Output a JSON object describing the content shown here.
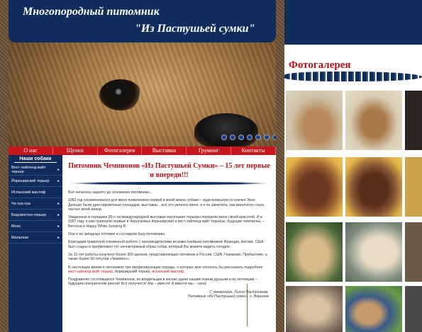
{
  "header": {
    "title": "Многопородный питомник",
    "subtitle": "\"Из Пастушьей сумки\""
  },
  "nav": [
    "О нас",
    "Щенки",
    "Фотогалерея",
    "Выставки",
    "Груминг",
    "Контакты"
  ],
  "sidebar": {
    "title": "Наши собаки",
    "items": [
      "Вест-хайленд-вайт терьер",
      "Йоркширский терьер",
      "Испанский мастиф",
      "Чи хуа хуа",
      "Бедлингтон-терьер",
      "Мопс",
      "Мальтезе"
    ]
  },
  "content": {
    "title": "Питомник Чемпионов «Из Пастушьей Сумки» – 15 лет первые и впереди!!!",
    "p1": "Всё началось задолго до основания питомника...",
    "p2": "1982 год ознаменовался для меня появлением первой в моей жизни собаки – эрдельтерьера по кличке Экон. Дальше были дрессировочные площадки, выставки... всё это увлекло меня, и я не заметила, как кинология стала частью моей жизни.",
    "p3": "Увиденные в середине 90-х на международной выставке маленькие терьеры покорили меня своей красотой. И в 1997 году к нам приехали первые в Черноземье йоркширский и вест-хайленд-вайт терьеры, будущие чемпионы, – Биттина и Happy White Jumping B.",
    "p4": "Они и их звёздные потомки и составили базу питомника.",
    "p5": "Благодаря грамотной племенной работе с производителями из известнейших питомников Франции, Англии, США был создан и преумножен тот неповторимый образ собак, который Вы можете видеть сегодня.",
    "p6": "За 15 лет работы получено более 300 щенков, представляющих питомник в России, США, Германии, Прибалтике, а также более 50 титулов «Чемпион».",
    "p7a": "В настоящее время в питомнике три профилирующие породы, о которых мне хотелось бы рассказать подробнее: ",
    "p7b": "вест-хайленд-вайт терьер",
    "p7c": ", йоркширский терьер, ",
    "p7d": "испанский мастиф",
    "p7e": ".",
    "p8": "Поздравляю состоявшихся Чемпионов, их владельцев и желаю удачи нашим новым друзьям и их питомцам – будущим покорителям рингов! Всё получится! Мы – вместе! А вместе мы – сила!",
    "sign1": "С уважением, Лилия Пастушкова,",
    "sign2": "Питомник «Из Пастушьей сумки», г. Воронеж"
  },
  "gallery": {
    "title": "Фотогалерея"
  },
  "colors": {
    "navy": "#0f2c5c",
    "red": "#c8161d",
    "title_red": "#b5121b"
  }
}
